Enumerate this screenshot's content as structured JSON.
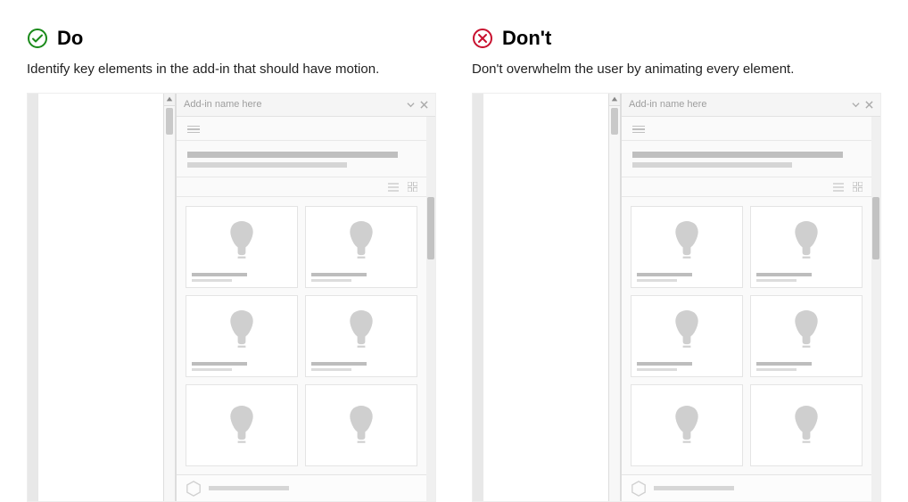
{
  "do": {
    "title": "Do",
    "description": "Identify key elements in the add-in that should have motion.",
    "icon_color": "#1a8a1a",
    "pane_title": "Add-in name here"
  },
  "dont": {
    "title": "Don't",
    "description": "Don't overwhelm the user by animating every element.",
    "icon_color": "#c8102e",
    "pane_title": "Add-in name here"
  }
}
